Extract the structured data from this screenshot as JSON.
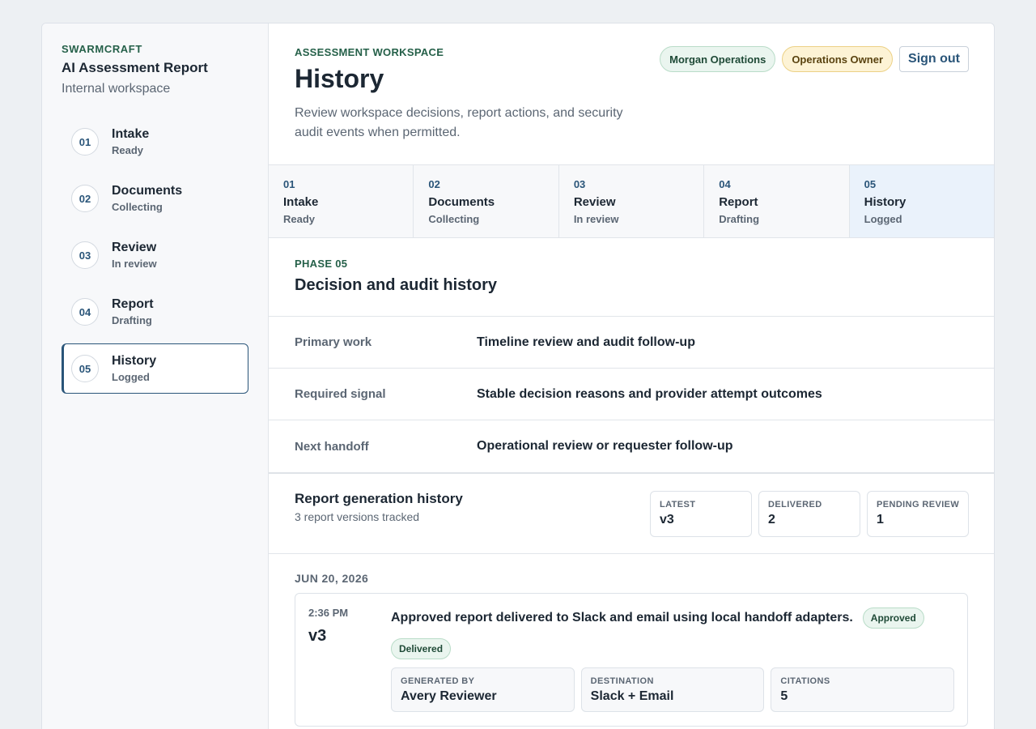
{
  "sidebar": {
    "brand": "SWARMCRAFT",
    "title": "AI Assessment Report",
    "subtitle": "Internal workspace",
    "items": [
      {
        "num": "01",
        "label": "Intake",
        "status": "Ready"
      },
      {
        "num": "02",
        "label": "Documents",
        "status": "Collecting"
      },
      {
        "num": "03",
        "label": "Review",
        "status": "In review"
      },
      {
        "num": "04",
        "label": "Report",
        "status": "Drafting"
      },
      {
        "num": "05",
        "label": "History",
        "status": "Logged",
        "active": true
      }
    ]
  },
  "header": {
    "eyebrow": "ASSESSMENT WORKSPACE",
    "title": "History",
    "description": "Review workspace decisions, report actions, and security audit events when permitted.",
    "user": "Morgan Operations",
    "role": "Operations Owner",
    "signout_label": "Sign out"
  },
  "phase_tabs": [
    {
      "num": "01",
      "label": "Intake",
      "status": "Ready"
    },
    {
      "num": "02",
      "label": "Documents",
      "status": "Collecting"
    },
    {
      "num": "03",
      "label": "Review",
      "status": "In review"
    },
    {
      "num": "04",
      "label": "Report",
      "status": "Drafting"
    },
    {
      "num": "05",
      "label": "History",
      "status": "Logged",
      "active": true
    }
  ],
  "phase": {
    "eyebrow": "PHASE 05",
    "title": "Decision and audit history",
    "rows": [
      {
        "key": "Primary work",
        "value": "Timeline review and audit follow-up"
      },
      {
        "key": "Required signal",
        "value": "Stable decision reasons and provider attempt outcomes"
      },
      {
        "key": "Next handoff",
        "value": "Operational review or requester follow-up"
      }
    ]
  },
  "report_history": {
    "title": "Report generation history",
    "subtitle": "3 report versions tracked",
    "stats": [
      {
        "label": "LATEST",
        "value": "v3"
      },
      {
        "label": "DELIVERED",
        "value": "2"
      },
      {
        "label": "PENDING REVIEW",
        "value": "1"
      }
    ]
  },
  "timeline": {
    "date": "JUN 20, 2026",
    "entries": [
      {
        "time": "2:36 PM",
        "version": "v3",
        "message": "Approved report delivered to Slack and email using local handoff adapters.",
        "status_badge": "Approved",
        "delivery_badge": "Delivered",
        "meta": [
          {
            "label": "GENERATED BY",
            "value": "Avery Reviewer"
          },
          {
            "label": "DESTINATION",
            "value": "Slack + Email"
          },
          {
            "label": "CITATIONS",
            "value": "5"
          }
        ]
      }
    ]
  }
}
